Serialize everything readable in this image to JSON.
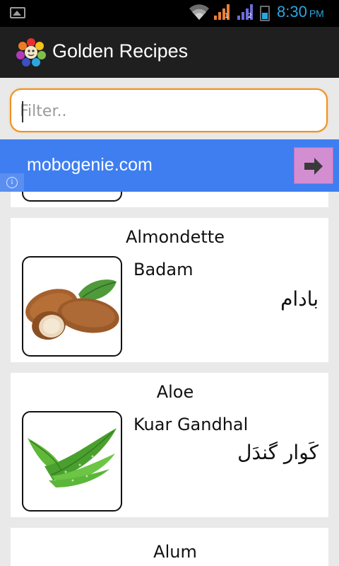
{
  "status_bar": {
    "time": "8:30",
    "ampm": "PM",
    "icons": [
      "image-notification-icon",
      "wifi-icon",
      "signal-sim1-icon",
      "signal-sim2-icon",
      "battery-icon"
    ],
    "sim1_label": "1",
    "sim2_label": "2"
  },
  "app_bar": {
    "title": "Golden Recipes",
    "icon": "app-logo-icon"
  },
  "filter": {
    "placeholder": "Filter..",
    "value": ""
  },
  "ad": {
    "text": "mobogenie.com",
    "arrow_icon": "arrow-right-icon",
    "info_icon": "info-icon"
  },
  "items": [
    {
      "title": "Almondette",
      "name": "Badam",
      "urdu": "بادام",
      "image_icon": "almond-image"
    },
    {
      "title": "Aloe",
      "name": "Kuar Gandhal",
      "urdu": "کَوار گندَل",
      "image_icon": "aloe-image"
    },
    {
      "title": "Alum",
      "name": "",
      "urdu": "",
      "image_icon": ""
    }
  ],
  "colors": {
    "accent_orange": "#f0911f",
    "ad_blue": "#3e7ef0",
    "status_blue": "#2aa7e0",
    "action_bar": "#1f1f1f"
  }
}
